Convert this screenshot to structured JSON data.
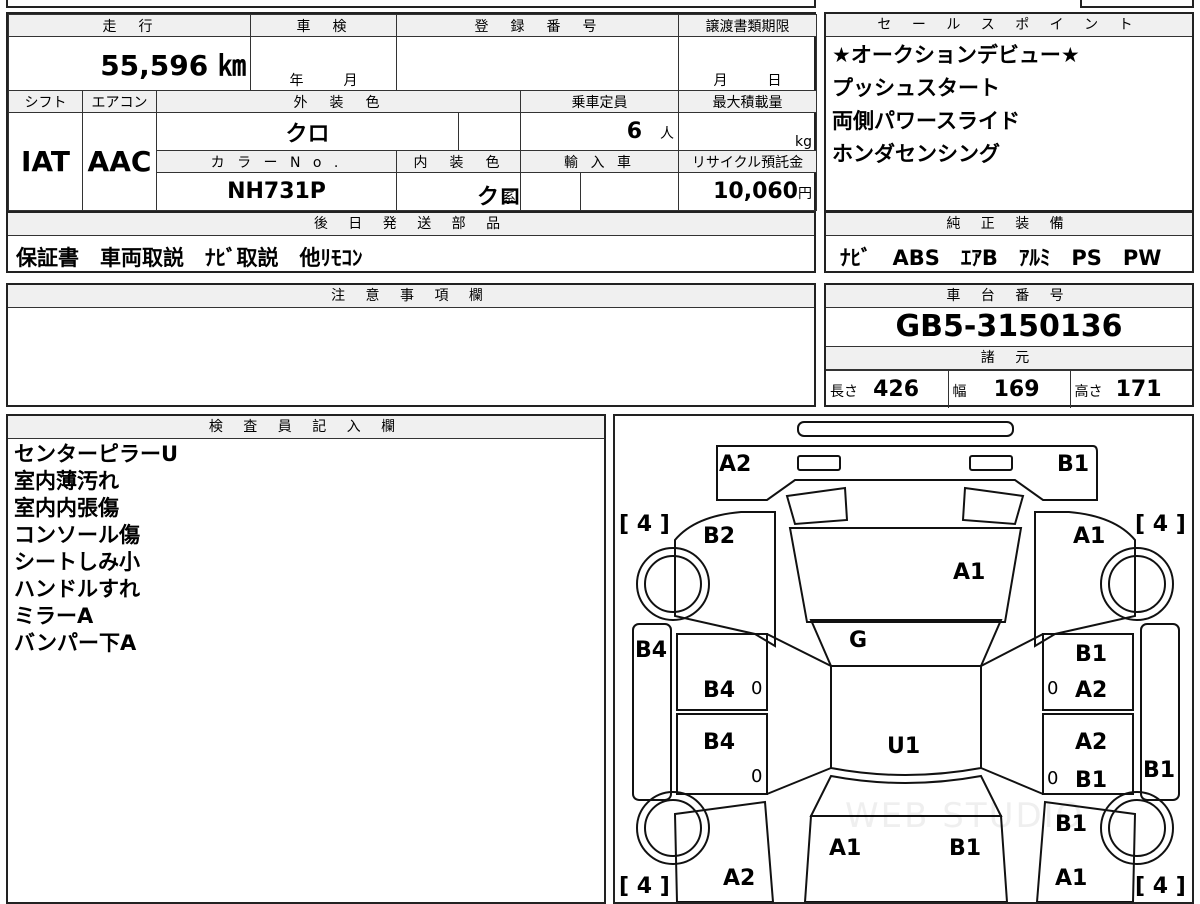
{
  "vehicle_spec": {
    "headers": {
      "mileage": "走　行",
      "inspection": "車　検",
      "registration": "登　録　番　号",
      "transfer_deadline": "譲渡書類期限",
      "shift": "シフト",
      "ac": "エアコン",
      "exterior_color": "外　装　色",
      "capacity": "乗車定員",
      "max_load": "最大積載量",
      "color_no": "カ ラ ー N o .",
      "interior_color": "内　装　色",
      "import": "輸 入 車",
      "recycle_fee": "リサイクル預託金"
    },
    "mileage": "55,596 ㎞",
    "inspection_year_unit": "年",
    "inspection_month_unit": "月",
    "deadline_month_unit": "月",
    "deadline_day_unit": "日",
    "shift": "IAT",
    "ac": "AAC",
    "exterior_color": "クロ",
    "capacity": "6",
    "capacity_unit": "人",
    "max_load_unit": "kg",
    "color_no": "NH731P",
    "interior_color": "クロ",
    "interior_suffix": "系",
    "recycle_fee": "10,060",
    "recycle_unit": "円"
  },
  "later_parts": {
    "header": "後 日 発 送 部 品",
    "items": "保証書　車両取説　ﾅﾋﾞ取説　他ﾘﾓｺﾝ"
  },
  "notes": {
    "header": "注 意 事 項 欄",
    "text": ""
  },
  "sales_points": {
    "header": "セ ー ル ス ポ イ ン ト",
    "items": [
      "★オークションデビュー★",
      "プッシュスタート",
      "両側パワースライド",
      "ホンダセンシング"
    ]
  },
  "equipment": {
    "header": "純 正 装 備",
    "items": "ﾅﾋﾞ　ABS　ｴｱB　ｱﾙﾐ　PS　PW"
  },
  "chassis": {
    "header": "車 台 番 号",
    "number": "GB5-3150136"
  },
  "dimensions": {
    "header": "諸 元",
    "length_label": "長さ",
    "length": "426",
    "width_label": "幅",
    "width": "169",
    "height_label": "高さ",
    "height": "171"
  },
  "inspector": {
    "header": "検 査 員 記 入 欄",
    "lines": [
      "センターピラーU",
      "室内薄汚れ",
      "室内内張傷",
      "コンソール傷",
      "シートしみ小",
      "ハンドルすれ",
      "ミラーA",
      "バンパー下A"
    ]
  },
  "diagram": {
    "tire_front_left": "4",
    "tire_front_right": "4",
    "tire_rear_left": "4",
    "tire_rear_right": "4",
    "labels": {
      "a2_front_left": "A2",
      "b1_front_right": "B1",
      "b2_left": "B2",
      "a1_right_front": "A1",
      "a1_hood": "A1",
      "g_windshield": "G",
      "b4_left_side": "B4",
      "b1_right_upper": "B1",
      "b4_front_door": "B4",
      "a2_right_front_door": "A2",
      "u1_roof": "U1",
      "b4_rear_door": "B4",
      "a2_right_rear": "A2",
      "b1_right_rear_door": "B1",
      "b1_right_side": "B1",
      "b1_right_lower": "B1",
      "a1_rear_left": "A1",
      "b1_rear_right": "B1",
      "a2_rear_left": "A2",
      "a1_rear_right": "A1"
    },
    "zero": "0",
    "watermark": "WEB STUDIO"
  }
}
